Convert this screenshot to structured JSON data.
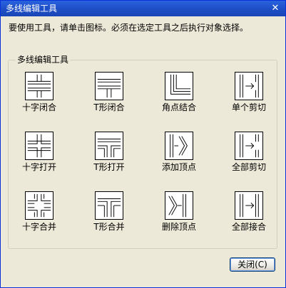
{
  "window": {
    "title": "多线编辑工具",
    "close_glyph": "✕"
  },
  "instruction": "要使用工具，请单击图标。必须在选定工具之后执行对象选择。",
  "group": {
    "label": "多线编辑工具",
    "tools": [
      {
        "label": "十字闭合",
        "icon": "cross-closed-icon"
      },
      {
        "label": "T形闭合",
        "icon": "tee-closed-icon"
      },
      {
        "label": "角点结合",
        "icon": "corner-joint-icon"
      },
      {
        "label": "单个剪切",
        "icon": "cut-single-icon"
      },
      {
        "label": "十字打开",
        "icon": "cross-open-icon"
      },
      {
        "label": "T形打开",
        "icon": "tee-open-icon"
      },
      {
        "label": "添加顶点",
        "icon": "add-vertex-icon"
      },
      {
        "label": "全部剪切",
        "icon": "cut-all-icon"
      },
      {
        "label": "十字合并",
        "icon": "cross-merged-icon"
      },
      {
        "label": "T形合并",
        "icon": "tee-merged-icon"
      },
      {
        "label": "删除顶点",
        "icon": "delete-vertex-icon"
      },
      {
        "label": "全部接合",
        "icon": "weld-all-icon"
      }
    ]
  },
  "close_button": {
    "label": "关闭(C)"
  }
}
